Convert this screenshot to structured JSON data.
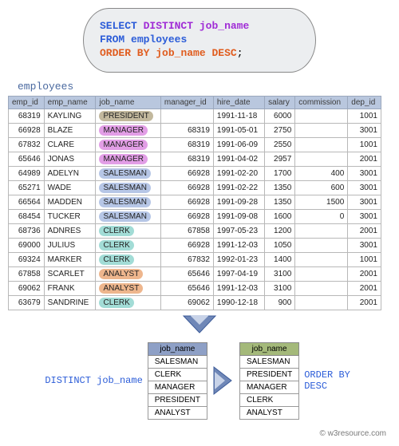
{
  "sql": {
    "select": "SELECT",
    "distinct": "DISTINCT",
    "col": "job_name",
    "from": "FROM",
    "table": "employees",
    "orderby": "ORDER BY",
    "ordercol": "job_name",
    "desc": "DESC",
    "semi": ";"
  },
  "table_label": "employees",
  "headers": {
    "emp_id": "emp_id",
    "emp_name": "emp_name",
    "job_name": "job_name",
    "manager_id": "manager_id",
    "hire_date": "hire_date",
    "salary": "salary",
    "commission": "commission",
    "dep_id": "dep_id"
  },
  "rows": [
    {
      "emp_id": "68319",
      "emp_name": "KAYLING",
      "job_name": "PRESIDENT",
      "job_class": "cell-president",
      "manager_id": "",
      "hire_date": "1991-11-18",
      "salary": "6000",
      "commission": "",
      "dep_id": "1001"
    },
    {
      "emp_id": "66928",
      "emp_name": "BLAZE",
      "job_name": "MANAGER",
      "job_class": "cell-manager",
      "manager_id": "68319",
      "hire_date": "1991-05-01",
      "salary": "2750",
      "commission": "",
      "dep_id": "3001"
    },
    {
      "emp_id": "67832",
      "emp_name": "CLARE",
      "job_name": "MANAGER",
      "job_class": "cell-manager",
      "manager_id": "68319",
      "hire_date": "1991-06-09",
      "salary": "2550",
      "commission": "",
      "dep_id": "1001"
    },
    {
      "emp_id": "65646",
      "emp_name": "JONAS",
      "job_name": "MANAGER",
      "job_class": "cell-manager",
      "manager_id": "68319",
      "hire_date": "1991-04-02",
      "salary": "2957",
      "commission": "",
      "dep_id": "2001"
    },
    {
      "emp_id": "64989",
      "emp_name": "ADELYN",
      "job_name": "SALESMAN",
      "job_class": "cell-salesman",
      "manager_id": "66928",
      "hire_date": "1991-02-20",
      "salary": "1700",
      "commission": "400",
      "dep_id": "3001"
    },
    {
      "emp_id": "65271",
      "emp_name": "WADE",
      "job_name": "SALESMAN",
      "job_class": "cell-salesman",
      "manager_id": "66928",
      "hire_date": "1991-02-22",
      "salary": "1350",
      "commission": "600",
      "dep_id": "3001"
    },
    {
      "emp_id": "66564",
      "emp_name": "MADDEN",
      "job_name": "SALESMAN",
      "job_class": "cell-salesman",
      "manager_id": "66928",
      "hire_date": "1991-09-28",
      "salary": "1350",
      "commission": "1500",
      "dep_id": "3001"
    },
    {
      "emp_id": "68454",
      "emp_name": "TUCKER",
      "job_name": "SALESMAN",
      "job_class": "cell-salesman",
      "manager_id": "66928",
      "hire_date": "1991-09-08",
      "salary": "1600",
      "commission": "0",
      "dep_id": "3001"
    },
    {
      "emp_id": "68736",
      "emp_name": "ADNRES",
      "job_name": "CLERK",
      "job_class": "cell-clerk",
      "manager_id": "67858",
      "hire_date": "1997-05-23",
      "salary": "1200",
      "commission": "",
      "dep_id": "2001"
    },
    {
      "emp_id": "69000",
      "emp_name": "JULIUS",
      "job_name": "CLERK",
      "job_class": "cell-clerk",
      "manager_id": "66928",
      "hire_date": "1991-12-03",
      "salary": "1050",
      "commission": "",
      "dep_id": "3001"
    },
    {
      "emp_id": "69324",
      "emp_name": "MARKER",
      "job_name": "CLERK",
      "job_class": "cell-clerk",
      "manager_id": "67832",
      "hire_date": "1992-01-23",
      "salary": "1400",
      "commission": "",
      "dep_id": "1001"
    },
    {
      "emp_id": "67858",
      "emp_name": "SCARLET",
      "job_name": "ANALYST",
      "job_class": "cell-analyst",
      "manager_id": "65646",
      "hire_date": "1997-04-19",
      "salary": "3100",
      "commission": "",
      "dep_id": "2001"
    },
    {
      "emp_id": "69062",
      "emp_name": "FRANK",
      "job_name": "ANALYST",
      "job_class": "cell-analyst",
      "manager_id": "65646",
      "hire_date": "1991-12-03",
      "salary": "3100",
      "commission": "",
      "dep_id": "2001"
    },
    {
      "emp_id": "63679",
      "emp_name": "SANDRINE",
      "job_name": "CLERK",
      "job_class": "cell-clerk",
      "manager_id": "69062",
      "hire_date": "1990-12-18",
      "salary": "900",
      "commission": "",
      "dep_id": "2001"
    }
  ],
  "distinct_label": "DISTINCT job_name",
  "order_label_line1": "ORDER BY",
  "order_label_line2": "DESC",
  "mini_header": "job_name",
  "distinct_values": [
    "SALESMAN",
    "CLERK",
    "MANAGER",
    "PRESIDENT",
    "ANALYST"
  ],
  "ordered_values": [
    "SALESMAN",
    "PRESIDENT",
    "MANAGER",
    "CLERK",
    "ANALYST"
  ],
  "footer": "© w3resource.com"
}
